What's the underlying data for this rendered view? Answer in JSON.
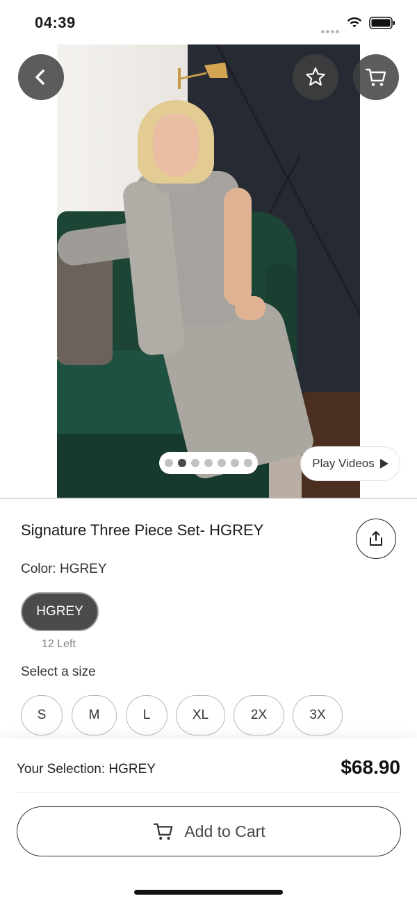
{
  "status_bar": {
    "time": "04:39"
  },
  "hero": {
    "pager": {
      "count": 7,
      "active_index": 1
    },
    "play_videos_label": "Play Videos"
  },
  "product": {
    "title": "Signature Three Piece Set- HGREY",
    "color_label": "Color: HGREY",
    "color_option": "HGREY",
    "stock_text": "12 Left",
    "size_label": "Select a size",
    "sizes": [
      "S",
      "M",
      "L",
      "XL",
      "2X",
      "3X"
    ]
  },
  "bottom_bar": {
    "selection_text": "Your Selection: HGREY",
    "price": "$68.90",
    "add_to_cart_label": "Add to Cart"
  },
  "icons": {
    "back": "chevron-left-icon",
    "favorite": "star-icon",
    "cart": "cart-icon",
    "share": "share-icon",
    "play": "play-icon"
  },
  "colors": {
    "nav_button_bg": "#404040",
    "selected_chip_bg": "#4b4b4d",
    "pager_active": "#4a4a4a",
    "pager_inactive": "#c2c2c2"
  }
}
